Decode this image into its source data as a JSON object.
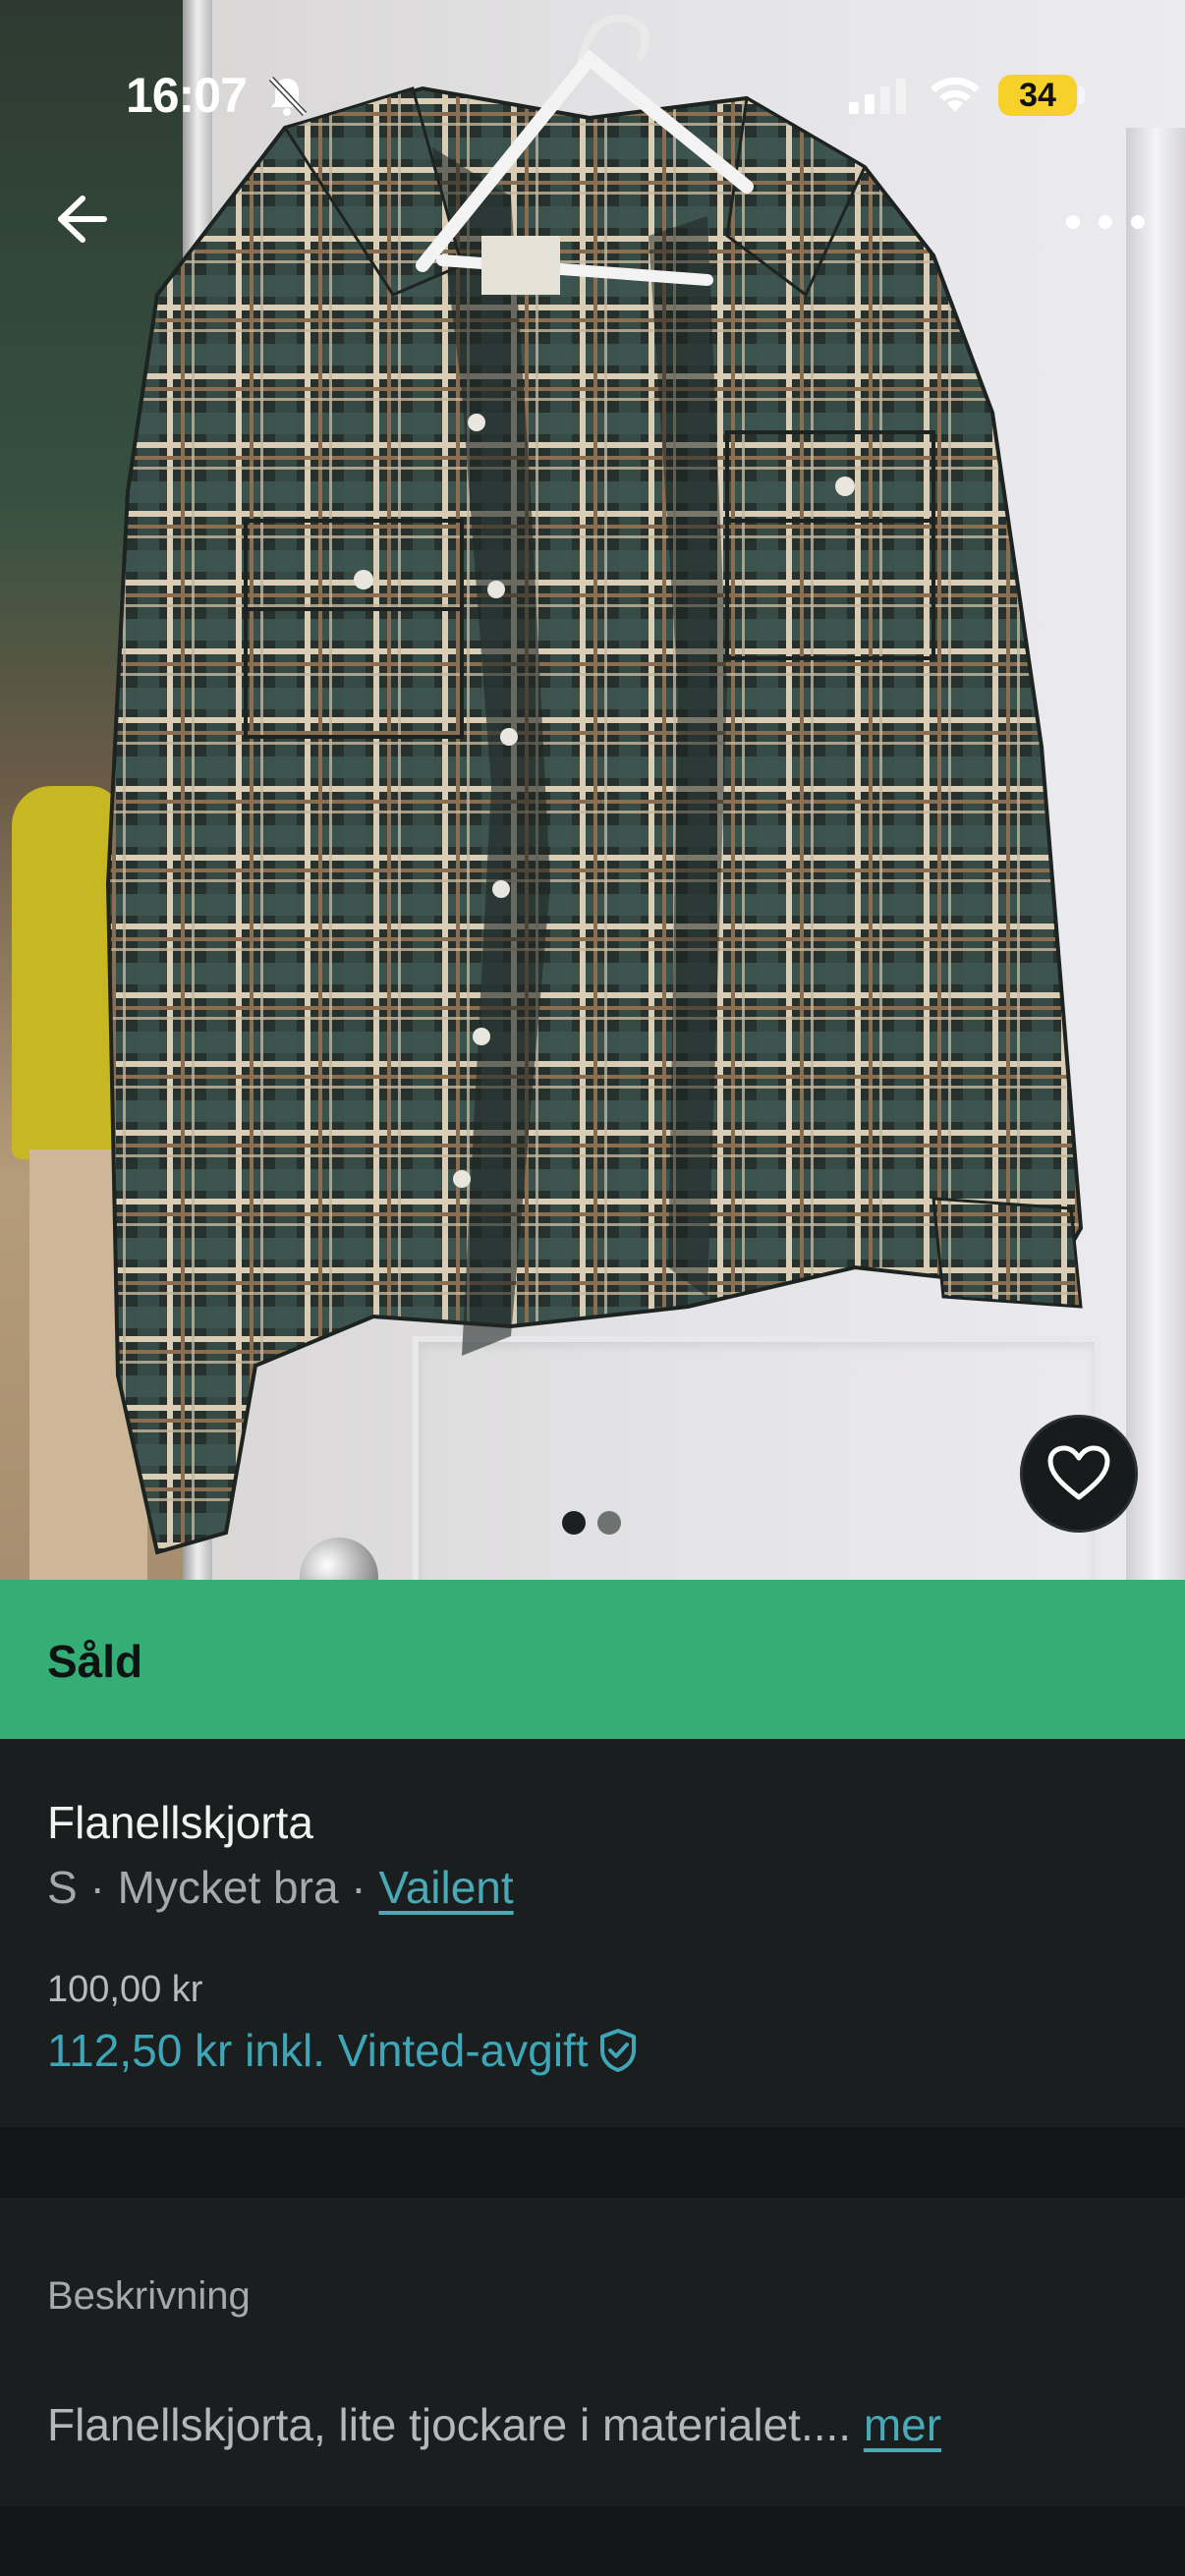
{
  "status_bar": {
    "time": "16:07",
    "battery": "34",
    "icons": [
      "bell-slash-icon",
      "signal-icon",
      "wifi-icon",
      "battery-icon"
    ]
  },
  "top_bar": {
    "back_icon": "arrow-left-icon",
    "more_icon": "more-dots-icon"
  },
  "gallery": {
    "photo_count": 2,
    "current_index": 1,
    "favorite_icon": "heart-icon"
  },
  "banner": {
    "label": "Såld",
    "color": "#34ae74"
  },
  "item": {
    "title": "Flanellskjorta",
    "size": "S",
    "separator": " · ",
    "condition": "Mycket bra",
    "brand": "Vailent",
    "price": "100,00 kr",
    "price_incl": "112,50 kr inkl. Vinted-avgift",
    "shield_icon": "shield-check-icon"
  },
  "description": {
    "heading": "Beskrivning",
    "text": "Flanellskjorta, lite tjockare i materialet.... ",
    "more_label": "mer"
  },
  "colors": {
    "accent": "#49a9b7",
    "background": "#121617",
    "card": "#1a1e1f"
  }
}
